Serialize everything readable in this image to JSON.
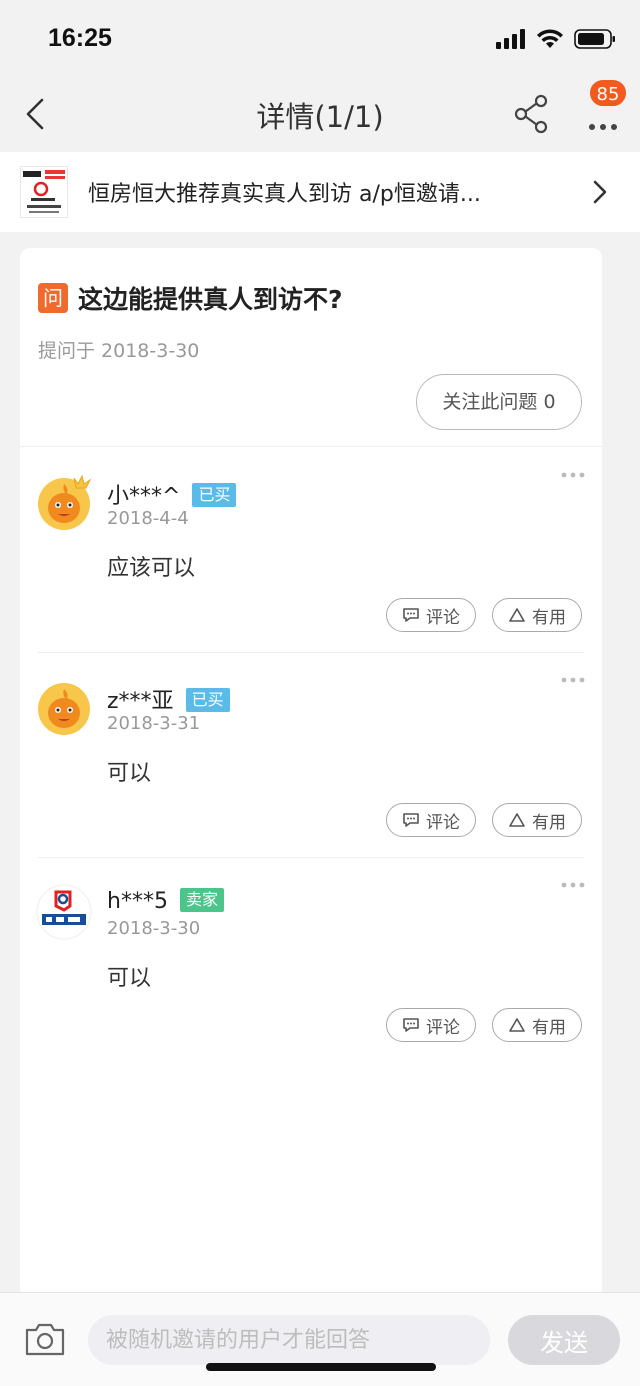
{
  "status_bar": {
    "time": "16:25"
  },
  "nav": {
    "title": "详情(1/1)",
    "badge_count": "85"
  },
  "product": {
    "title": "恒房恒大推荐真实真人到访 a/p恒邀请..."
  },
  "question": {
    "icon_text": "问",
    "title": "这边能提供真人到访不?",
    "date": "提问于 2018-3-30",
    "follow_label": "关注此问题 0"
  },
  "answers": [
    {
      "username": "小***^",
      "tag": "已买",
      "tag_color": "#5bbbe8",
      "date": "2018-4-4",
      "text": "应该可以",
      "comment_label": "评论",
      "useful_label": "有用"
    },
    {
      "username": "z***亚",
      "tag": "已买",
      "tag_color": "#5bbbe8",
      "date": "2018-3-31",
      "text": "可以",
      "comment_label": "评论",
      "useful_label": "有用"
    },
    {
      "username": "h***5",
      "tag": "卖家",
      "tag_color": "#4cc58a",
      "date": "2018-3-30",
      "text": "可以",
      "comment_label": "评论",
      "useful_label": "有用"
    }
  ],
  "bottom": {
    "placeholder": "被随机邀请的用户才能回答",
    "send_label": "发送"
  },
  "colors": {
    "accent": "#f06a2c",
    "badge": "#f25a1f"
  }
}
